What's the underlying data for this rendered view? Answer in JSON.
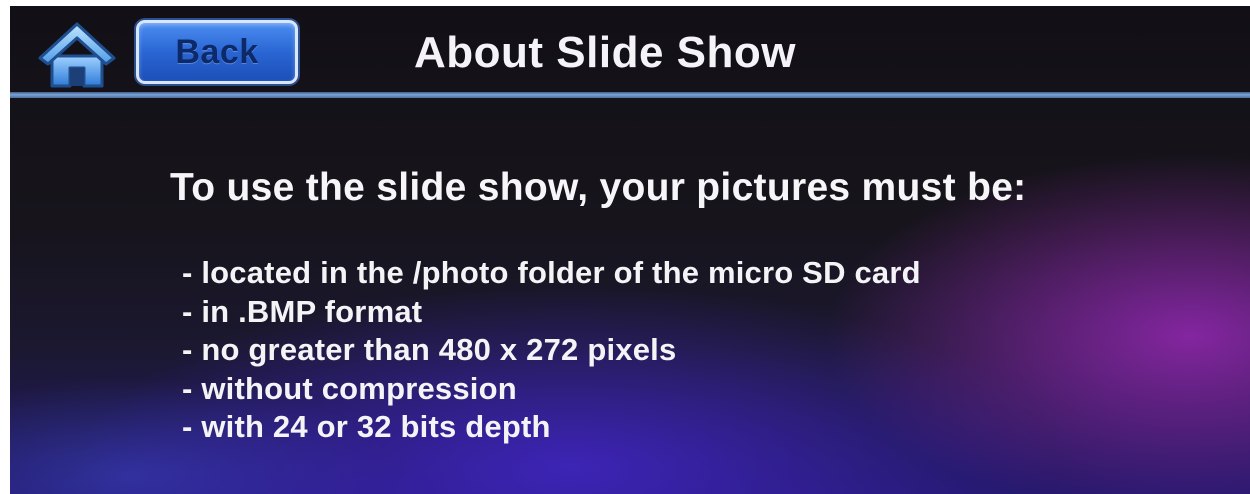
{
  "header": {
    "home_icon": "home-icon",
    "back_label": "Back",
    "title": "About Slide Show"
  },
  "main": {
    "intro": "To use the slide show, your pictures must be:",
    "requirements": [
      "- located in the /photo folder of the micro SD card",
      "- in .BMP format",
      "- no greater than 480 x 272 pixels",
      "- without compression",
      "- with 24 or 32 bits depth"
    ]
  },
  "colors": {
    "accent_blue": "#2a66d4",
    "header_rule": "#7aa3d6",
    "text": "#f4f4f6",
    "background_dark": "#141218",
    "background_glow_purple": "#9628b4",
    "background_glow_blue": "#4628d2"
  }
}
